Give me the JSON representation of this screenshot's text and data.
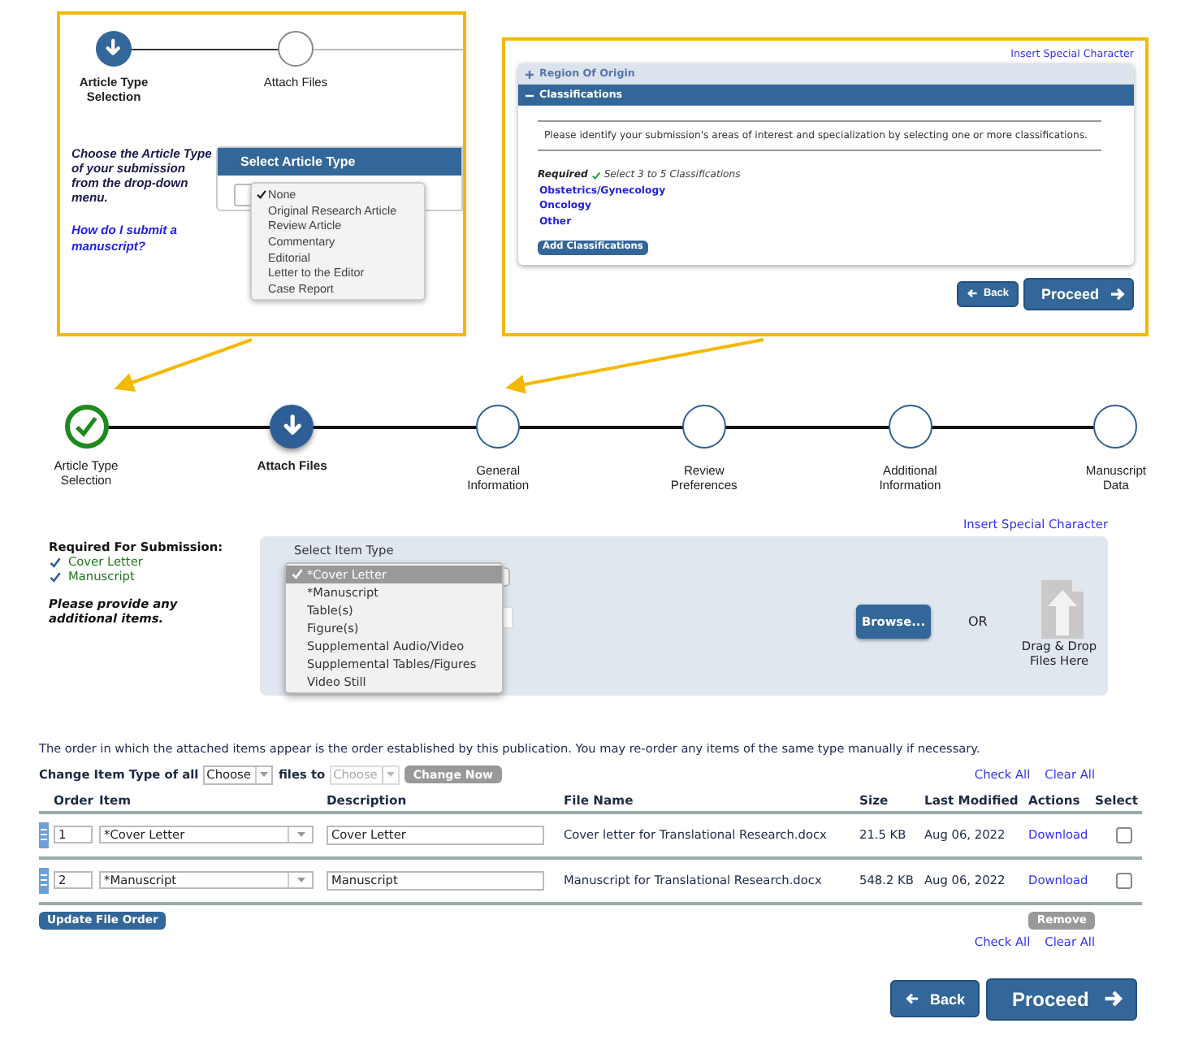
{
  "article_type_callout": {
    "steps": [
      {
        "label": "Article Type Selection",
        "completed": false,
        "current": true
      },
      {
        "label": "Attach Files",
        "completed": false,
        "current": false
      }
    ],
    "instruction": "Choose the Article Type of your submission from the drop-down menu.",
    "help_link": "How do I submit a manuscript?",
    "panel_title": "Select Article Type",
    "menu": [
      {
        "label": "None",
        "selected": true
      },
      {
        "label": "Original Research Article",
        "selected": false
      },
      {
        "label": "Review Article",
        "selected": false
      },
      {
        "label": "Commentary",
        "selected": false
      },
      {
        "label": "Editorial",
        "selected": false
      },
      {
        "label": "Letter to the Editor",
        "selected": false
      },
      {
        "label": "Case Report",
        "selected": false
      }
    ]
  },
  "classifications_callout": {
    "special_char_link": "Insert Special Character",
    "sections": [
      {
        "title": "Region Of Origin",
        "expanded": false
      },
      {
        "title": "Classifications",
        "expanded": true
      }
    ],
    "description": "Please identify your submission's areas of interest and specialization by selecting one or more classifications.",
    "required_label": "Required",
    "requirement": "Select 3 to 5 Classifications",
    "classifications": [
      "Obstetrics/Gynecology",
      "Oncology",
      "Other"
    ],
    "add_button": "Add Classifications",
    "back_button": "Back",
    "proceed_button": "Proceed"
  },
  "stepper": [
    {
      "label": "Article Type Selection",
      "completed": true,
      "current": false
    },
    {
      "label": "Attach Files",
      "completed": false,
      "current": true
    },
    {
      "label": "General Information",
      "completed": false,
      "current": false
    },
    {
      "label": "Review Preferences",
      "completed": false,
      "current": false
    },
    {
      "label": "Additional Information",
      "completed": false,
      "current": false
    },
    {
      "label": "Manuscript Data",
      "completed": false,
      "current": false
    }
  ],
  "attach": {
    "special_char_link": "Insert Special Character",
    "required_title": "Required For Submission:",
    "required_items": [
      {
        "label": "Cover Letter",
        "checked": true
      },
      {
        "label": "Manuscript",
        "checked": true
      }
    ],
    "prompt": "Please provide any additional items.",
    "select_label": "Select Item Type",
    "item_menu": [
      {
        "label": "*Cover Letter",
        "selected": true
      },
      {
        "label": "*Manuscript",
        "selected": false
      },
      {
        "label": "Table(s)",
        "selected": false
      },
      {
        "label": "Figure(s)",
        "selected": false
      },
      {
        "label": "Supplemental Audio/Video",
        "selected": false
      },
      {
        "label": "Supplemental Tables/Figures",
        "selected": false
      },
      {
        "label": "Video Still",
        "selected": false
      }
    ],
    "browse_button": "Browse...",
    "or_text": "OR",
    "drop_label": "Drag & Drop Files Here"
  },
  "files": {
    "note": "The order in which the attached items appear is the order established by this publication. You may re-order any items of the same type manually if necessary.",
    "change_type": {
      "label_before": "Change Item Type of all",
      "from_placeholder": "Choose",
      "label_middle": "files to",
      "to_placeholder": "Choose",
      "to_disabled": true,
      "button": "Change Now",
      "button_disabled": true
    },
    "check_all": "Check All",
    "clear_all": "Clear All",
    "columns": [
      "Order",
      "Item",
      "Description",
      "File Name",
      "Size",
      "Last Modified",
      "Actions",
      "Select"
    ],
    "rows": [
      {
        "order": "1",
        "item": "*Cover Letter",
        "description": "Cover Letter",
        "file_name": "Cover letter for Translational Research.docx",
        "size": "21.5 KB",
        "last_modified": "Aug 06, 2022",
        "action": "Download",
        "selected": false
      },
      {
        "order": "2",
        "item": "*Manuscript",
        "description": "Manuscript",
        "file_name": "Manuscript for Translational Research.docx",
        "size": "548.2 KB",
        "last_modified": "Aug 06, 2022",
        "action": "Download",
        "selected": false
      }
    ],
    "update_button": "Update File Order",
    "remove_button": "Remove",
    "remove_disabled": true,
    "footer_check_all": "Check All",
    "footer_clear_all": "Clear All"
  },
  "nav": {
    "back": "Back",
    "proceed": "Proceed"
  }
}
